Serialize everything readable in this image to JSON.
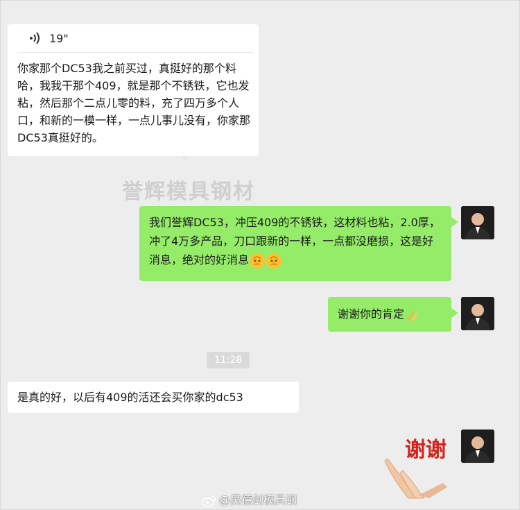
{
  "chat": {
    "voice": {
      "duration": "19\""
    },
    "msg1": {
      "text": "你家那个DC53我之前买过，真挺好的那个料哈，我我干那个409，就是那个不锈铁，它也发粘，然后那个二点儿零的料，充了四万多个人口，和新的一模一样，一点儿事儿没有，你家那DC53真挺好的。"
    },
    "msg2": {
      "text": "我们誉辉DC53，冲压409的不锈铁，这材料也粘，2.0厚，冲了4万多产品，刀口跟新的一样，一点都没磨损，这是好消息，绝对的好消息"
    },
    "msg3": {
      "text": "谢谢你的肯定"
    },
    "time": "11:28",
    "msg4": {
      "text": "是真的好，以后有409的活还会买你家的dc53"
    },
    "sticker_text": "谢谢"
  },
  "watermark": {
    "brand": "誉辉模具钢材"
  },
  "weibo": {
    "handle": "@吴德剑模具钢"
  },
  "colors": {
    "bg": "#ededed",
    "self_bubble": "#95ec69",
    "other_bubble": "#ffffff",
    "sticker_text": "#d3211c"
  },
  "icons": [
    "voice-wave-icon",
    "pray-emoji-icon",
    "clap-emoji-icon",
    "weibo-logo-icon"
  ]
}
